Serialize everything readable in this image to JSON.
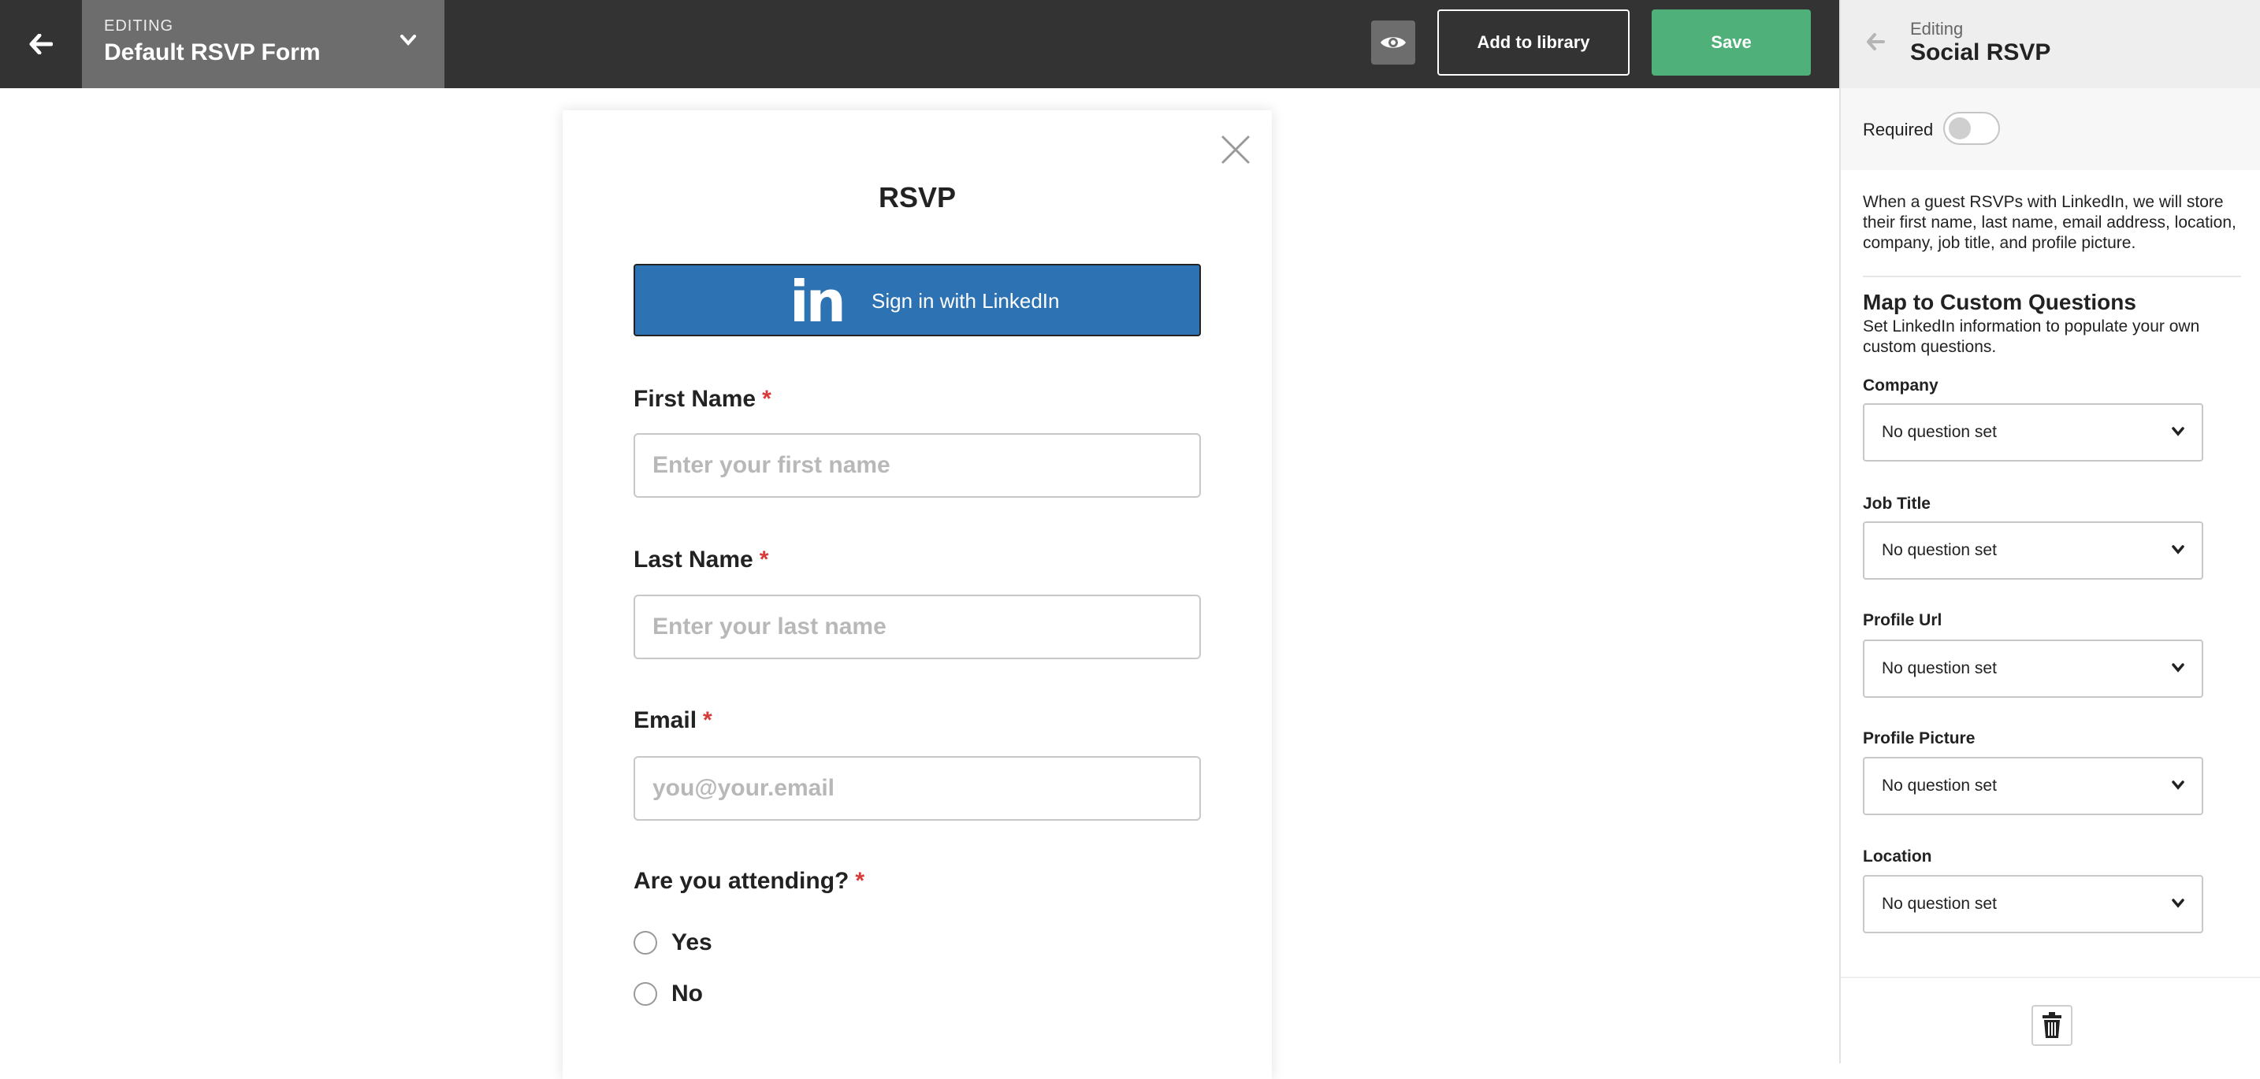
{
  "topbar": {
    "editing_kicker": "EDITING",
    "form_name": "Default RSVP Form",
    "add_to_library_label": "Add to library",
    "save_label": "Save"
  },
  "form": {
    "title": "RSVP",
    "linkedin_logo": "in",
    "linkedin_button_label": "Sign in with LinkedIn",
    "fields": [
      {
        "label": "First Name",
        "required_marker": "*",
        "placeholder": "Enter your first name"
      },
      {
        "label": "Last Name",
        "required_marker": "*",
        "placeholder": "Enter your last name"
      },
      {
        "label": "Email",
        "required_marker": "*",
        "placeholder": "you@your.email"
      }
    ],
    "attending": {
      "label": "Are you attending?",
      "required_marker": "*",
      "options": [
        "Yes",
        "No"
      ]
    }
  },
  "panel": {
    "kicker": "Editing",
    "title": "Social RSVP",
    "required_label": "Required",
    "required_on": false,
    "description": "When a guest RSVPs with LinkedIn, we will store their first name, last name, email address, location, company, job title, and profile picture.",
    "map_title": "Map to Custom Questions",
    "map_description": "Set LinkedIn information to populate your own custom questions.",
    "mappings": [
      {
        "label": "Company",
        "value": "No question set"
      },
      {
        "label": "Job Title",
        "value": "No question set"
      },
      {
        "label": "Profile Url",
        "value": "No question set"
      },
      {
        "label": "Profile Picture",
        "value": "No question set"
      },
      {
        "label": "Location",
        "value": "No question set"
      }
    ]
  },
  "colors": {
    "topbar_bg": "#333333",
    "save_green": "#4fb07a",
    "linkedin_blue": "#2d72b2",
    "required_red": "#d83a3a"
  },
  "icons": [
    "back-arrow-icon",
    "chevron-down-icon",
    "eye-icon",
    "close-icon",
    "linkedin-icon",
    "trash-icon"
  ]
}
